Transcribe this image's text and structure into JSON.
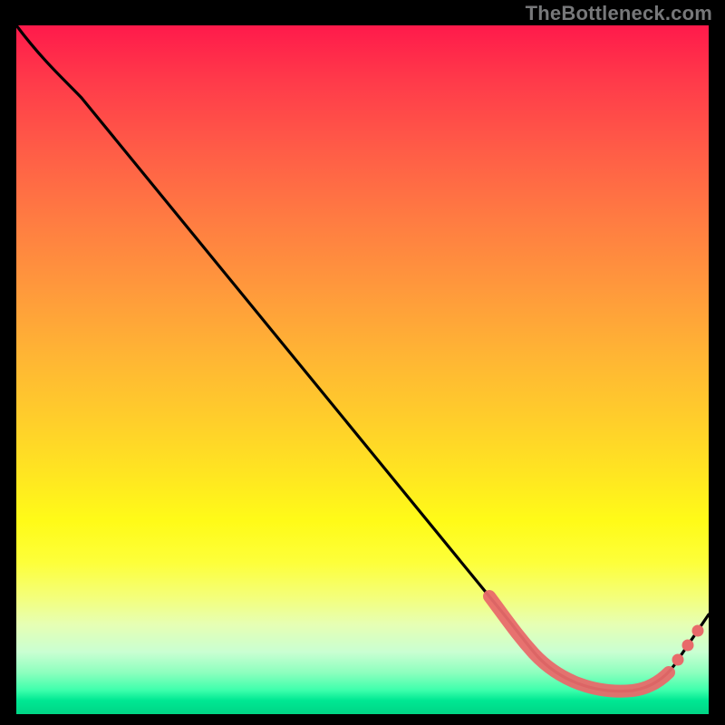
{
  "watermark": "TheBottleneck.com",
  "colors": {
    "curve": "#000000",
    "highlight": "#e86a6a",
    "gradient_top": "#ff1a4b",
    "gradient_bottom": "#00d586",
    "background": "#000000"
  },
  "chart_data": {
    "type": "line",
    "title": "",
    "xlabel": "",
    "ylabel": "",
    "xlim": [
      0,
      100
    ],
    "ylim": [
      0,
      100
    ],
    "x": [
      0,
      5,
      10,
      20,
      30,
      40,
      50,
      60,
      68,
      74,
      80,
      86,
      90,
      94,
      100
    ],
    "values": [
      100,
      93,
      90,
      78,
      66,
      54,
      42,
      30,
      20,
      12,
      6,
      3,
      3,
      7,
      15
    ],
    "highlight_range_x": [
      68,
      94
    ],
    "markers_x": [
      95.5,
      97,
      98.5
    ],
    "annotations": []
  }
}
